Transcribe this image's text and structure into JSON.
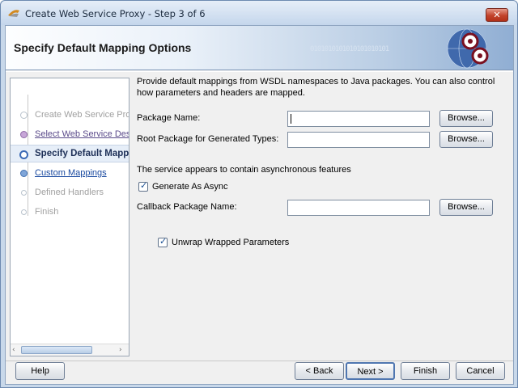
{
  "window": {
    "title": "Create Web Service Proxy - Step 3 of 6",
    "close_glyph": "✕"
  },
  "header": {
    "title": "Specify Default Mapping Options",
    "binary_pattern": "0101010101010101010101"
  },
  "steps": [
    {
      "label": "Create Web Service Proxy",
      "state": "done"
    },
    {
      "label": "Select Web Service Description",
      "state": "link"
    },
    {
      "label": "Specify Default Mapping Options",
      "state": "current"
    },
    {
      "label": "Custom Mappings",
      "state": "link"
    },
    {
      "label": "Defined Handlers",
      "state": "future"
    },
    {
      "label": "Finish",
      "state": "future"
    }
  ],
  "scroll": {
    "left": "‹",
    "right": "›"
  },
  "main": {
    "description": "Provide default mappings from WSDL namespaces to Java packages. You can also control how parameters and headers are mapped.",
    "package_name_label": "Package Name:",
    "package_name_value": "",
    "root_package_label": "Root Package for Generated Types:",
    "root_package_value": "",
    "browse_label": "Browse...",
    "async_notice": "The service appears to contain asynchronous features",
    "generate_async_label": "Generate As Async",
    "generate_async_checked": true,
    "callback_package_label": "Callback Package Name:",
    "callback_package_value": "",
    "unwrap_label": "Unwrap Wrapped Parameters",
    "unwrap_checked": true
  },
  "footer": {
    "help": "Help",
    "back": "< Back",
    "next": "Next >",
    "finish": "Finish",
    "cancel": "Cancel"
  },
  "colors": {
    "accent": "#1a4aa0",
    "header_gradient_end": "#90aed3"
  }
}
